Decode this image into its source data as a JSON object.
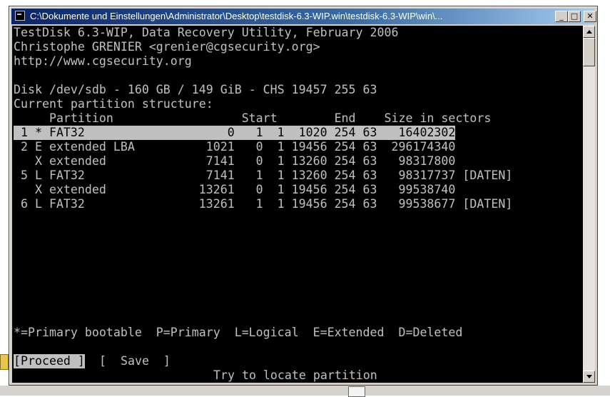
{
  "window": {
    "title": "C:\\Dokumente und Einstellungen\\Administrator\\Desktop\\testdisk-6.3-WIP.win\\testdisk-6.3-WIP\\win\\..."
  },
  "console": {
    "header": [
      "TestDisk 6.3-WIP, Data Recovery Utility, February 2006",
      "Christophe GRENIER <grenier@cgsecurity.org>",
      "http://www.cgsecurity.org"
    ],
    "disk_info": "Disk /dev/sdb - 160 GB / 149 GiB - CHS 19457 255 63",
    "structure_label": "Current partition structure:",
    "table_header": "     Partition                  Start        End    Size in sectors",
    "rows": [
      " 1 * FAT32                    0   1  1  1020 254 63   16402302",
      " 2 E extended LBA          1021   0  1 19456 254 63  296174340",
      "   X extended              7141   0  1 13260 254 63   98317800",
      " 5 L FAT32                 7141   1  1 13260 254 63   98317737 [DATEN]",
      "   X extended             13261   0  1 19456 254 63   99538740",
      " 6 L FAT32                13261   1  1 19456 254 63   99538677 [DATEN]"
    ],
    "legend": "*=Primary bootable  P=Primary  L=Logical  E=Extended  D=Deleted",
    "actions": {
      "proceed": "[Proceed ]",
      "save": "[  Save  ]"
    },
    "status": "Try to locate partition"
  },
  "icons": {
    "window_icon": "console-icon",
    "minimize": "minimize-icon",
    "maximize": "maximize-icon",
    "close": "close-icon"
  },
  "colors": {
    "console_bg": "#000000",
    "console_text": "#c0c0c0",
    "highlight_bg": "#c0c0c0",
    "titlebar": "#0a246a"
  }
}
